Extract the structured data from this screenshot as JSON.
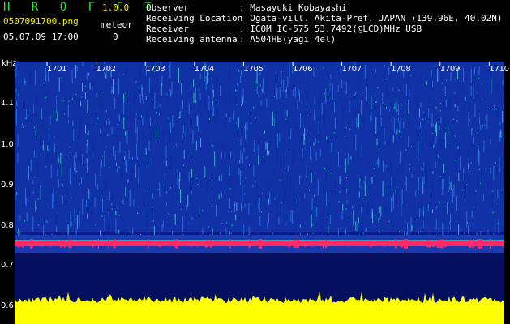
{
  "header": {
    "brand": "H R O F F T",
    "version": "1.0.0",
    "filename": "0507091700.png",
    "meteor_label": "meteor",
    "meteor_count": "0",
    "datetime": "05.07.09 17:00",
    "fields": [
      {
        "key": "Observer",
        "value": ": Masayuki Kobayashi"
      },
      {
        "key": "Receiving Location",
        "value": ": Ogata-vill. Akita-Pref. JAPAN (139.96E, 40.02N)"
      },
      {
        "key": "Receiver",
        "value": ": ICOM IC-575 53.7492(@LCD)MHz USB"
      },
      {
        "key": "Receiving antenna",
        "value": ": A504HB(yagi 4el)"
      }
    ]
  },
  "spectrogram": {
    "y_unit": "kHz",
    "y_ticks": [
      "1.1",
      "1.0",
      "0.9",
      "0.8",
      "0.7",
      "0.6"
    ],
    "minute_marks": [
      "1701",
      "1702",
      "1703",
      "1704",
      "1705",
      "1706",
      "1707",
      "1708",
      "1709",
      "1710"
    ],
    "colors": {
      "background": "#0a1a8c",
      "noise": "#1f5fd8",
      "signal": "#ff2a6a",
      "baseline": "#ffff00",
      "tick": "#ffffff"
    }
  }
}
